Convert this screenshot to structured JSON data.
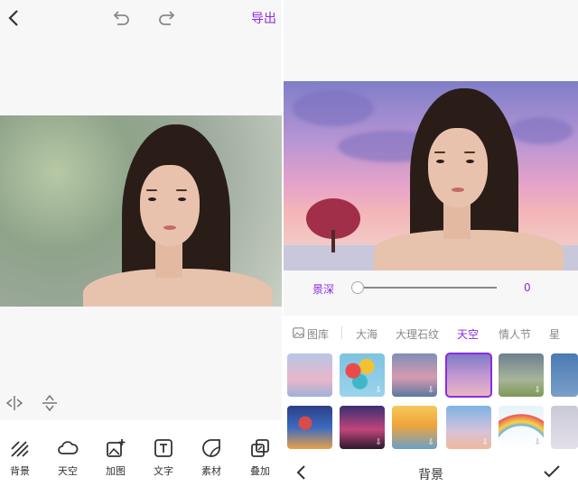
{
  "left": {
    "export_label": "导出",
    "tools": [
      {
        "label": "背景",
        "icon": "background-icon"
      },
      {
        "label": "天空",
        "icon": "sky-icon"
      },
      {
        "label": "加图",
        "icon": "add-image-icon"
      },
      {
        "label": "文字",
        "icon": "text-icon"
      },
      {
        "label": "素材",
        "icon": "sticker-icon"
      },
      {
        "label": "叠加",
        "icon": "overlay-icon"
      }
    ]
  },
  "right": {
    "depth_label": "景深",
    "depth_value": "0",
    "depth_fraction": 0,
    "tabs": [
      {
        "label": "图库",
        "active": false
      },
      {
        "label": "大海",
        "active": false
      },
      {
        "label": "大理石纹",
        "active": false
      },
      {
        "label": "天空",
        "active": true
      },
      {
        "label": "情人节",
        "active": false
      },
      {
        "label": "星",
        "active": false
      }
    ],
    "bottom_title": "背景",
    "accent_color": "#8a2be2"
  }
}
